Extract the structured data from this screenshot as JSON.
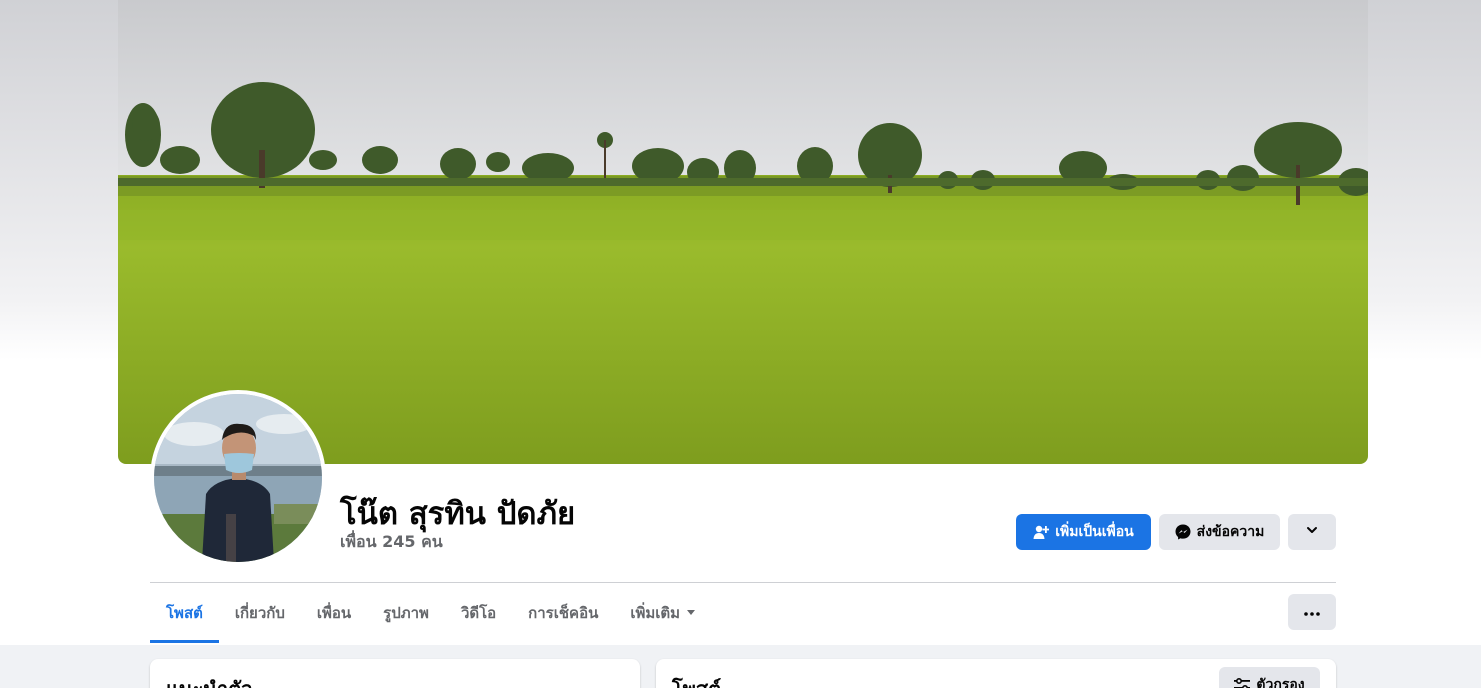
{
  "profile": {
    "name": "โน๊ต สุรทิน ปัดภัย",
    "friends_text": "เพื่อน 245 คน"
  },
  "actions": {
    "add_friend_label": "เพิ่มเป็นเพื่อน",
    "message_label": "ส่งข้อความ",
    "more_icon": "chevron-down-icon"
  },
  "tabs": [
    {
      "label": "โพสต์",
      "active": true
    },
    {
      "label": "เกี่ยวกับ",
      "active": false
    },
    {
      "label": "เพื่อน",
      "active": false
    },
    {
      "label": "รูปภาพ",
      "active": false
    },
    {
      "label": "วิดีโอ",
      "active": false
    },
    {
      "label": "การเช็คอิน",
      "active": false
    },
    {
      "label": "เพิ่มเติม",
      "active": false
    }
  ],
  "sections": {
    "intro_title": "แนะนำตัว",
    "posts_title": "โพสต์",
    "filter_label": "ตัวกรอง"
  },
  "colors": {
    "accent": "#1b74e4",
    "button_gray": "#e4e6eb",
    "background": "#f0f2f5"
  }
}
